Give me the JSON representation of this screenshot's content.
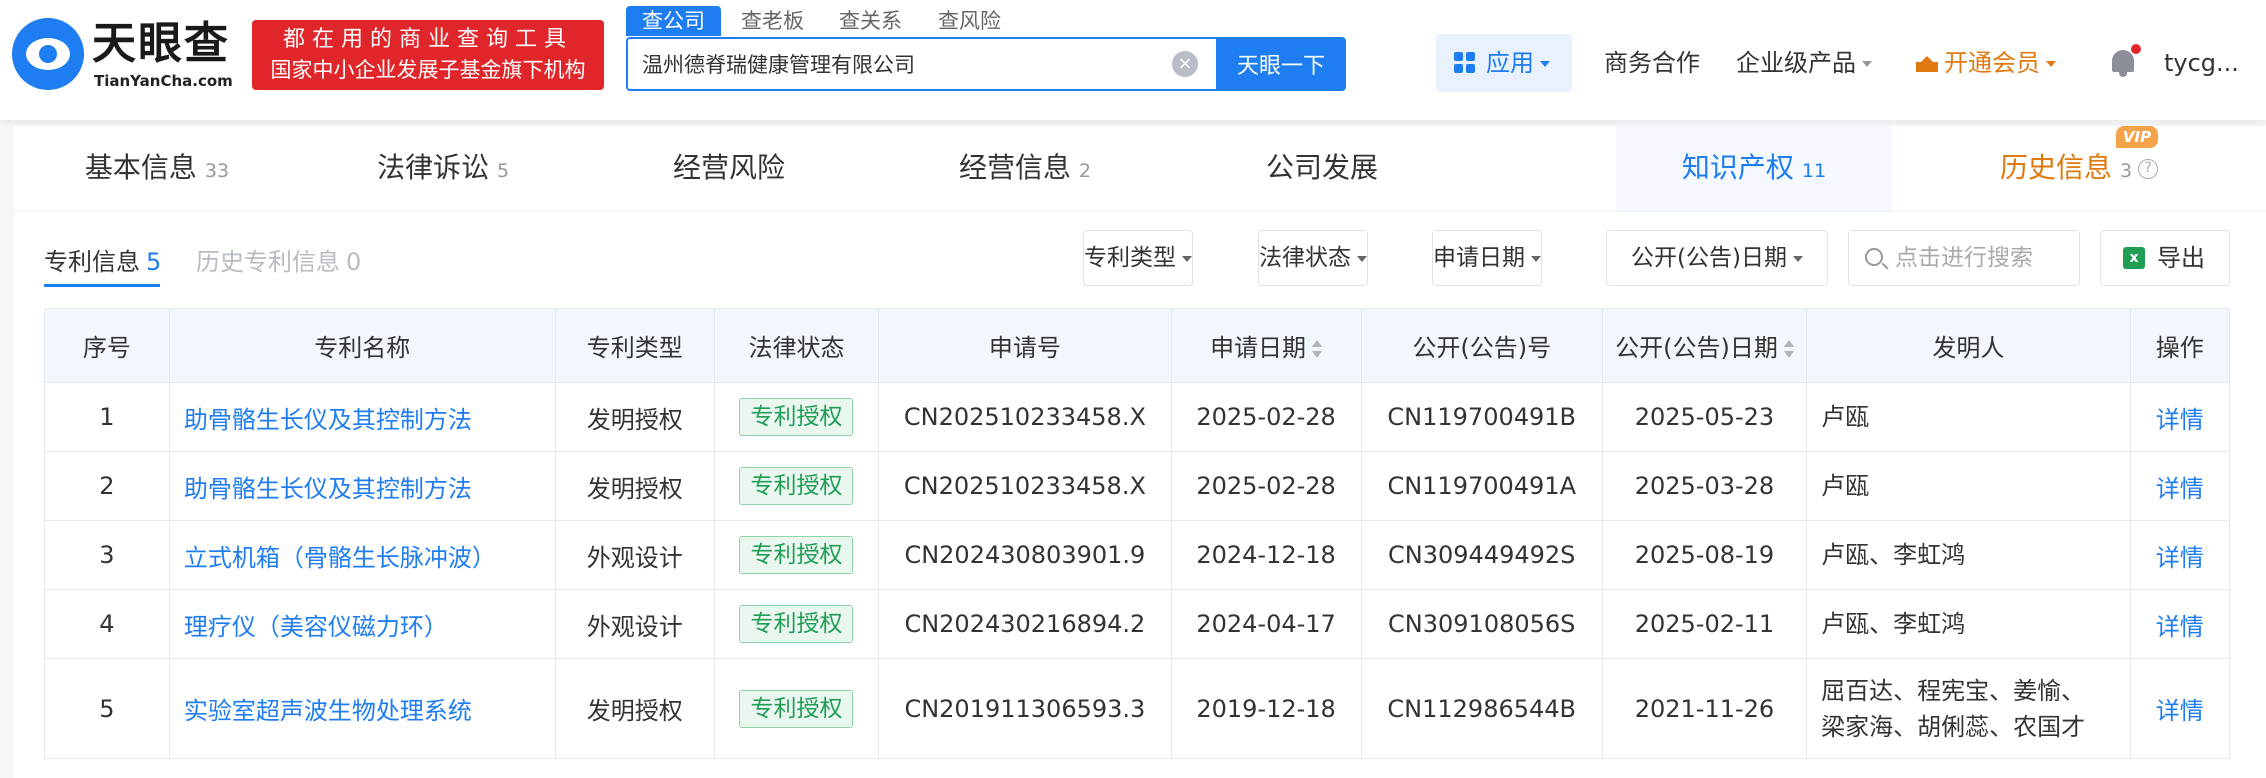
{
  "brand": {
    "name_cn": "天眼查",
    "name_en": "TianYanCha.com",
    "promo_line1": "都在用的商业查询工具",
    "promo_line2": "国家中小企业发展子基金旗下机构",
    "colors": {
      "primary": "#1e7df0",
      "promo": "#e0262a",
      "vip": "#e07a10"
    }
  },
  "search": {
    "tabs": [
      "查公司",
      "查老板",
      "查关系",
      "查风险"
    ],
    "value": "温州德脊瑞健康管理有限公司",
    "button": "天眼一下"
  },
  "topnav": {
    "apps": "应用",
    "business": "商务合作",
    "enterprise": "企业级产品",
    "vip": "开通会员",
    "user": "tycg..."
  },
  "tabs": [
    {
      "label": "基本信息",
      "count": "33"
    },
    {
      "label": "法律诉讼",
      "count": "5"
    },
    {
      "label": "经营风险",
      "count": ""
    },
    {
      "label": "经营信息",
      "count": "2"
    },
    {
      "label": "公司发展",
      "count": ""
    },
    {
      "label": "知识产权",
      "count": "11"
    },
    {
      "label": "历史信息",
      "count": "3",
      "badge": "VIP",
      "help": "?"
    }
  ],
  "subtabs": [
    {
      "label": "专利信息",
      "count": "5"
    },
    {
      "label": "历史专利信息",
      "count": "0"
    }
  ],
  "filters": {
    "type": "专利类型",
    "status": "法律状态",
    "apply_date": "申请日期",
    "pub_date": "公开(公告)日期",
    "search_placeholder": "点击进行搜索",
    "export": "导出"
  },
  "table": {
    "headers": [
      "序号",
      "专利名称",
      "专利类型",
      "法律状态",
      "申请号",
      "申请日期",
      "公开(公告)号",
      "公开(公告)日期",
      "发明人",
      "操作"
    ],
    "rows": [
      {
        "no": "1",
        "name": "助骨骼生长仪及其控制方法",
        "type": "发明授权",
        "status": "专利授权",
        "app_no": "CN202510233458.X",
        "app_date": "2025-02-28",
        "pub_no": "CN119700491B",
        "pub_date": "2025-05-23",
        "inventors": [
          "卢瓯"
        ],
        "action": "详情"
      },
      {
        "no": "2",
        "name": "助骨骼生长仪及其控制方法",
        "type": "发明授权",
        "status": "专利授权",
        "app_no": "CN202510233458.X",
        "app_date": "2025-02-28",
        "pub_no": "CN119700491A",
        "pub_date": "2025-03-28",
        "inventors": [
          "卢瓯"
        ],
        "action": "详情"
      },
      {
        "no": "3",
        "name": "立式机箱（骨骼生长脉冲波）",
        "type": "外观设计",
        "status": "专利授权",
        "app_no": "CN202430803901.9",
        "app_date": "2024-12-18",
        "pub_no": "CN309449492S",
        "pub_date": "2025-08-19",
        "inventors": [
          "卢瓯、李虹鸿"
        ],
        "action": "详情"
      },
      {
        "no": "4",
        "name": "理疗仪（美容仪磁力环）",
        "type": "外观设计",
        "status": "专利授权",
        "app_no": "CN202430216894.2",
        "app_date": "2024-04-17",
        "pub_no": "CN309108056S",
        "pub_date": "2025-02-11",
        "inventors": [
          "卢瓯、李虹鸿"
        ],
        "action": "详情"
      },
      {
        "no": "5",
        "name": "实验室超声波生物处理系统",
        "type": "发明授权",
        "status": "专利授权",
        "app_no": "CN201911306593.3",
        "app_date": "2019-12-18",
        "pub_no": "CN112986544B",
        "pub_date": "2021-11-26",
        "inventors": [
          "屈百达、程宪宝、姜愉、",
          "梁家海、胡俐蕊、农国才"
        ],
        "action": "详情"
      }
    ]
  }
}
